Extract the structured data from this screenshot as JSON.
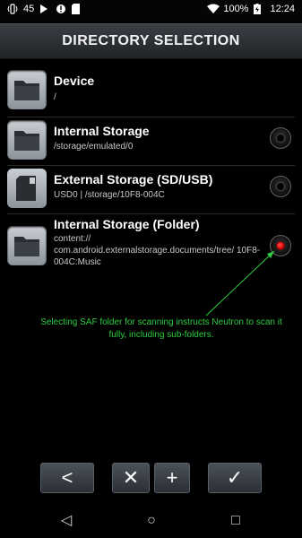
{
  "status": {
    "left_value": "45",
    "time": "12:24",
    "battery": "100%"
  },
  "title": "DIRECTORY SELECTION",
  "items": [
    {
      "title": "Device",
      "sub": "/"
    },
    {
      "title": "Internal Storage",
      "sub": "/storage/emulated/0"
    },
    {
      "title": "External Storage (SD/USB)",
      "sub": "USD0 | /storage/10F8-004C"
    },
    {
      "title": "Internal Storage (Folder)",
      "sub": "content:// com.android.externalstorage.documents/tree/ 10F8-004C:Music"
    }
  ],
  "selected_index": 3,
  "annotation": "Selecting SAF folder for scanning instructs Neutron to scan it fully, including sub-folders.",
  "annotation_color": "#2ecc40",
  "toolbar": {
    "back": "<",
    "remove": "✕",
    "add": "+",
    "confirm": "✓"
  },
  "nav": {
    "back": "◁",
    "home": "○",
    "recents": "□"
  }
}
